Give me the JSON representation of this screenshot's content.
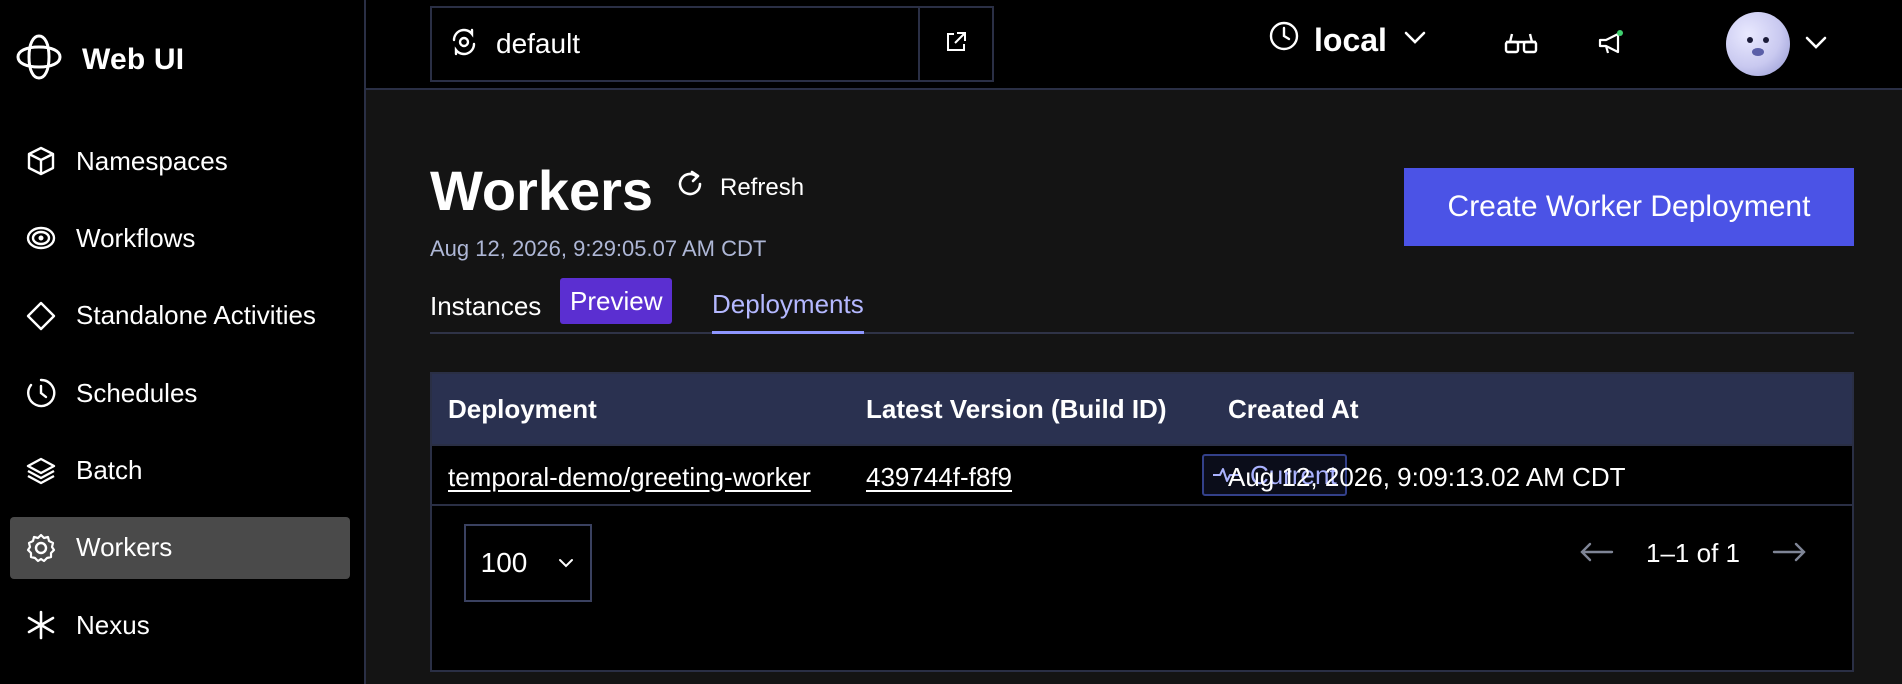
{
  "sidebar": {
    "brand": "Web UI",
    "items": [
      {
        "label": "Namespaces",
        "icon": "cube-icon"
      },
      {
        "label": "Workflows",
        "icon": "workflow-icon"
      },
      {
        "label": "Standalone Activities",
        "icon": "diamond-icon"
      },
      {
        "label": "Schedules",
        "icon": "clock-icon"
      },
      {
        "label": "Batch",
        "icon": "layers-icon"
      },
      {
        "label": "Workers",
        "icon": "gear-icon",
        "active": true
      },
      {
        "label": "Nexus",
        "icon": "asterisk-icon"
      }
    ]
  },
  "topbar": {
    "namespace": "default",
    "timezone": "local"
  },
  "page": {
    "title": "Workers",
    "refresh_label": "Refresh",
    "timestamp": "Aug 12, 2026, 9:29:05.07 AM CDT",
    "create_button": "Create Worker Deployment",
    "tabs": {
      "instances": "Instances",
      "preview_badge": "Preview",
      "deployments": "Deployments"
    }
  },
  "table": {
    "headers": {
      "deployment": "Deployment",
      "latest_version": "Latest Version (Build ID)",
      "created_at": "Created At"
    },
    "rows": [
      {
        "deployment": "temporal-demo/greeting-worker",
        "build_id": "439744f-f8f9",
        "status": "Current",
        "created_at": "Aug 12, 2026, 9:09:13.02 AM CDT"
      }
    ],
    "per_page": "100",
    "pagination": "1–1 of 1"
  }
}
